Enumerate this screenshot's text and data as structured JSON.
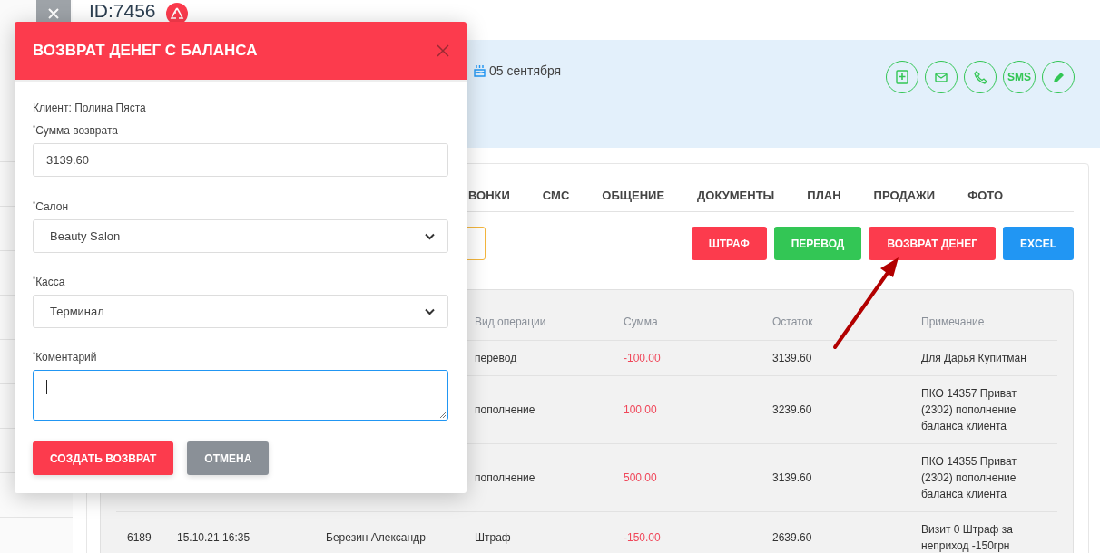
{
  "header": {
    "title": "ID:7456"
  },
  "client_panel": {
    "birthday": "05 сентября",
    "actions": [
      {
        "kind": "notebook"
      },
      {
        "kind": "mail"
      },
      {
        "kind": "phone"
      },
      {
        "kind": "text",
        "label": "SMS"
      },
      {
        "kind": "edit"
      }
    ]
  },
  "tabs": [
    {
      "label": "ВОНКИ"
    },
    {
      "label": "СМС"
    },
    {
      "label": "ОБЩЕНИЕ"
    },
    {
      "label": "ДОКУМЕНТЫ"
    },
    {
      "label": "ПЛАН"
    },
    {
      "label": "ПРОДАЖИ"
    },
    {
      "label": "ФОТО"
    }
  ],
  "buttons": [
    {
      "label": "ШТРАФ",
      "color": "#fc3b4d"
    },
    {
      "label": "ПЕРЕВОД",
      "color": "#33c655"
    },
    {
      "label": "ВОЗВРАТ ДЕНЕГ",
      "color": "#fc3b4d"
    },
    {
      "label": "EXCEL",
      "color": "#2196f3"
    }
  ],
  "table": {
    "columns": [
      "Вид операции",
      "Сумма",
      "Остаток",
      "Примечание"
    ],
    "rows": [
      {
        "operation": "перевод",
        "amount": "-100.00",
        "balance": "3139.60",
        "note": "Для Дарья Купитман"
      },
      {
        "operation": "пополнение",
        "amount": "100.00",
        "balance": "3239.60",
        "note": "ПКО 14357 Приват (2302) пополнение баланса клиента"
      },
      {
        "operation": "пополнение",
        "amount": "500.00",
        "balance": "3139.60",
        "note": "ПКО 14355 Приват (2302) пополнение баланса клиента"
      },
      {
        "column_1": "6189",
        "column_2": "15.10.21 16:35",
        "column_3": "Березин Александр",
        "operation": "Штраф",
        "amount": "-150.00",
        "balance": "2639.60",
        "note": "Визит 0 Штраф за неприход -150грн"
      }
    ]
  },
  "modal": {
    "title": "ВОЗВРАТ ДЕНЕГ С БАЛАНСА",
    "client": "Клиент: Полина Пяста",
    "fields": [
      {
        "kind": "input",
        "label": "$^{*}$Сумма возврата",
        "value": "3139.60"
      },
      {
        "kind": "select",
        "label": "$^{*}$Салон",
        "value": "Beauty Salon"
      },
      {
        "kind": "select",
        "label": "$^{*}$Касса",
        "value": "Терминал"
      },
      {
        "kind": "textarea",
        "label": "$^{*}$Коментарий",
        "focused": true
      }
    ],
    "buttons": [
      {
        "kind": "primary",
        "label": "СОЗДАТЬ ВОЗВРАТ"
      },
      {
        "kind": "secondary",
        "label": "ОТМЕНА"
      }
    ]
  }
}
